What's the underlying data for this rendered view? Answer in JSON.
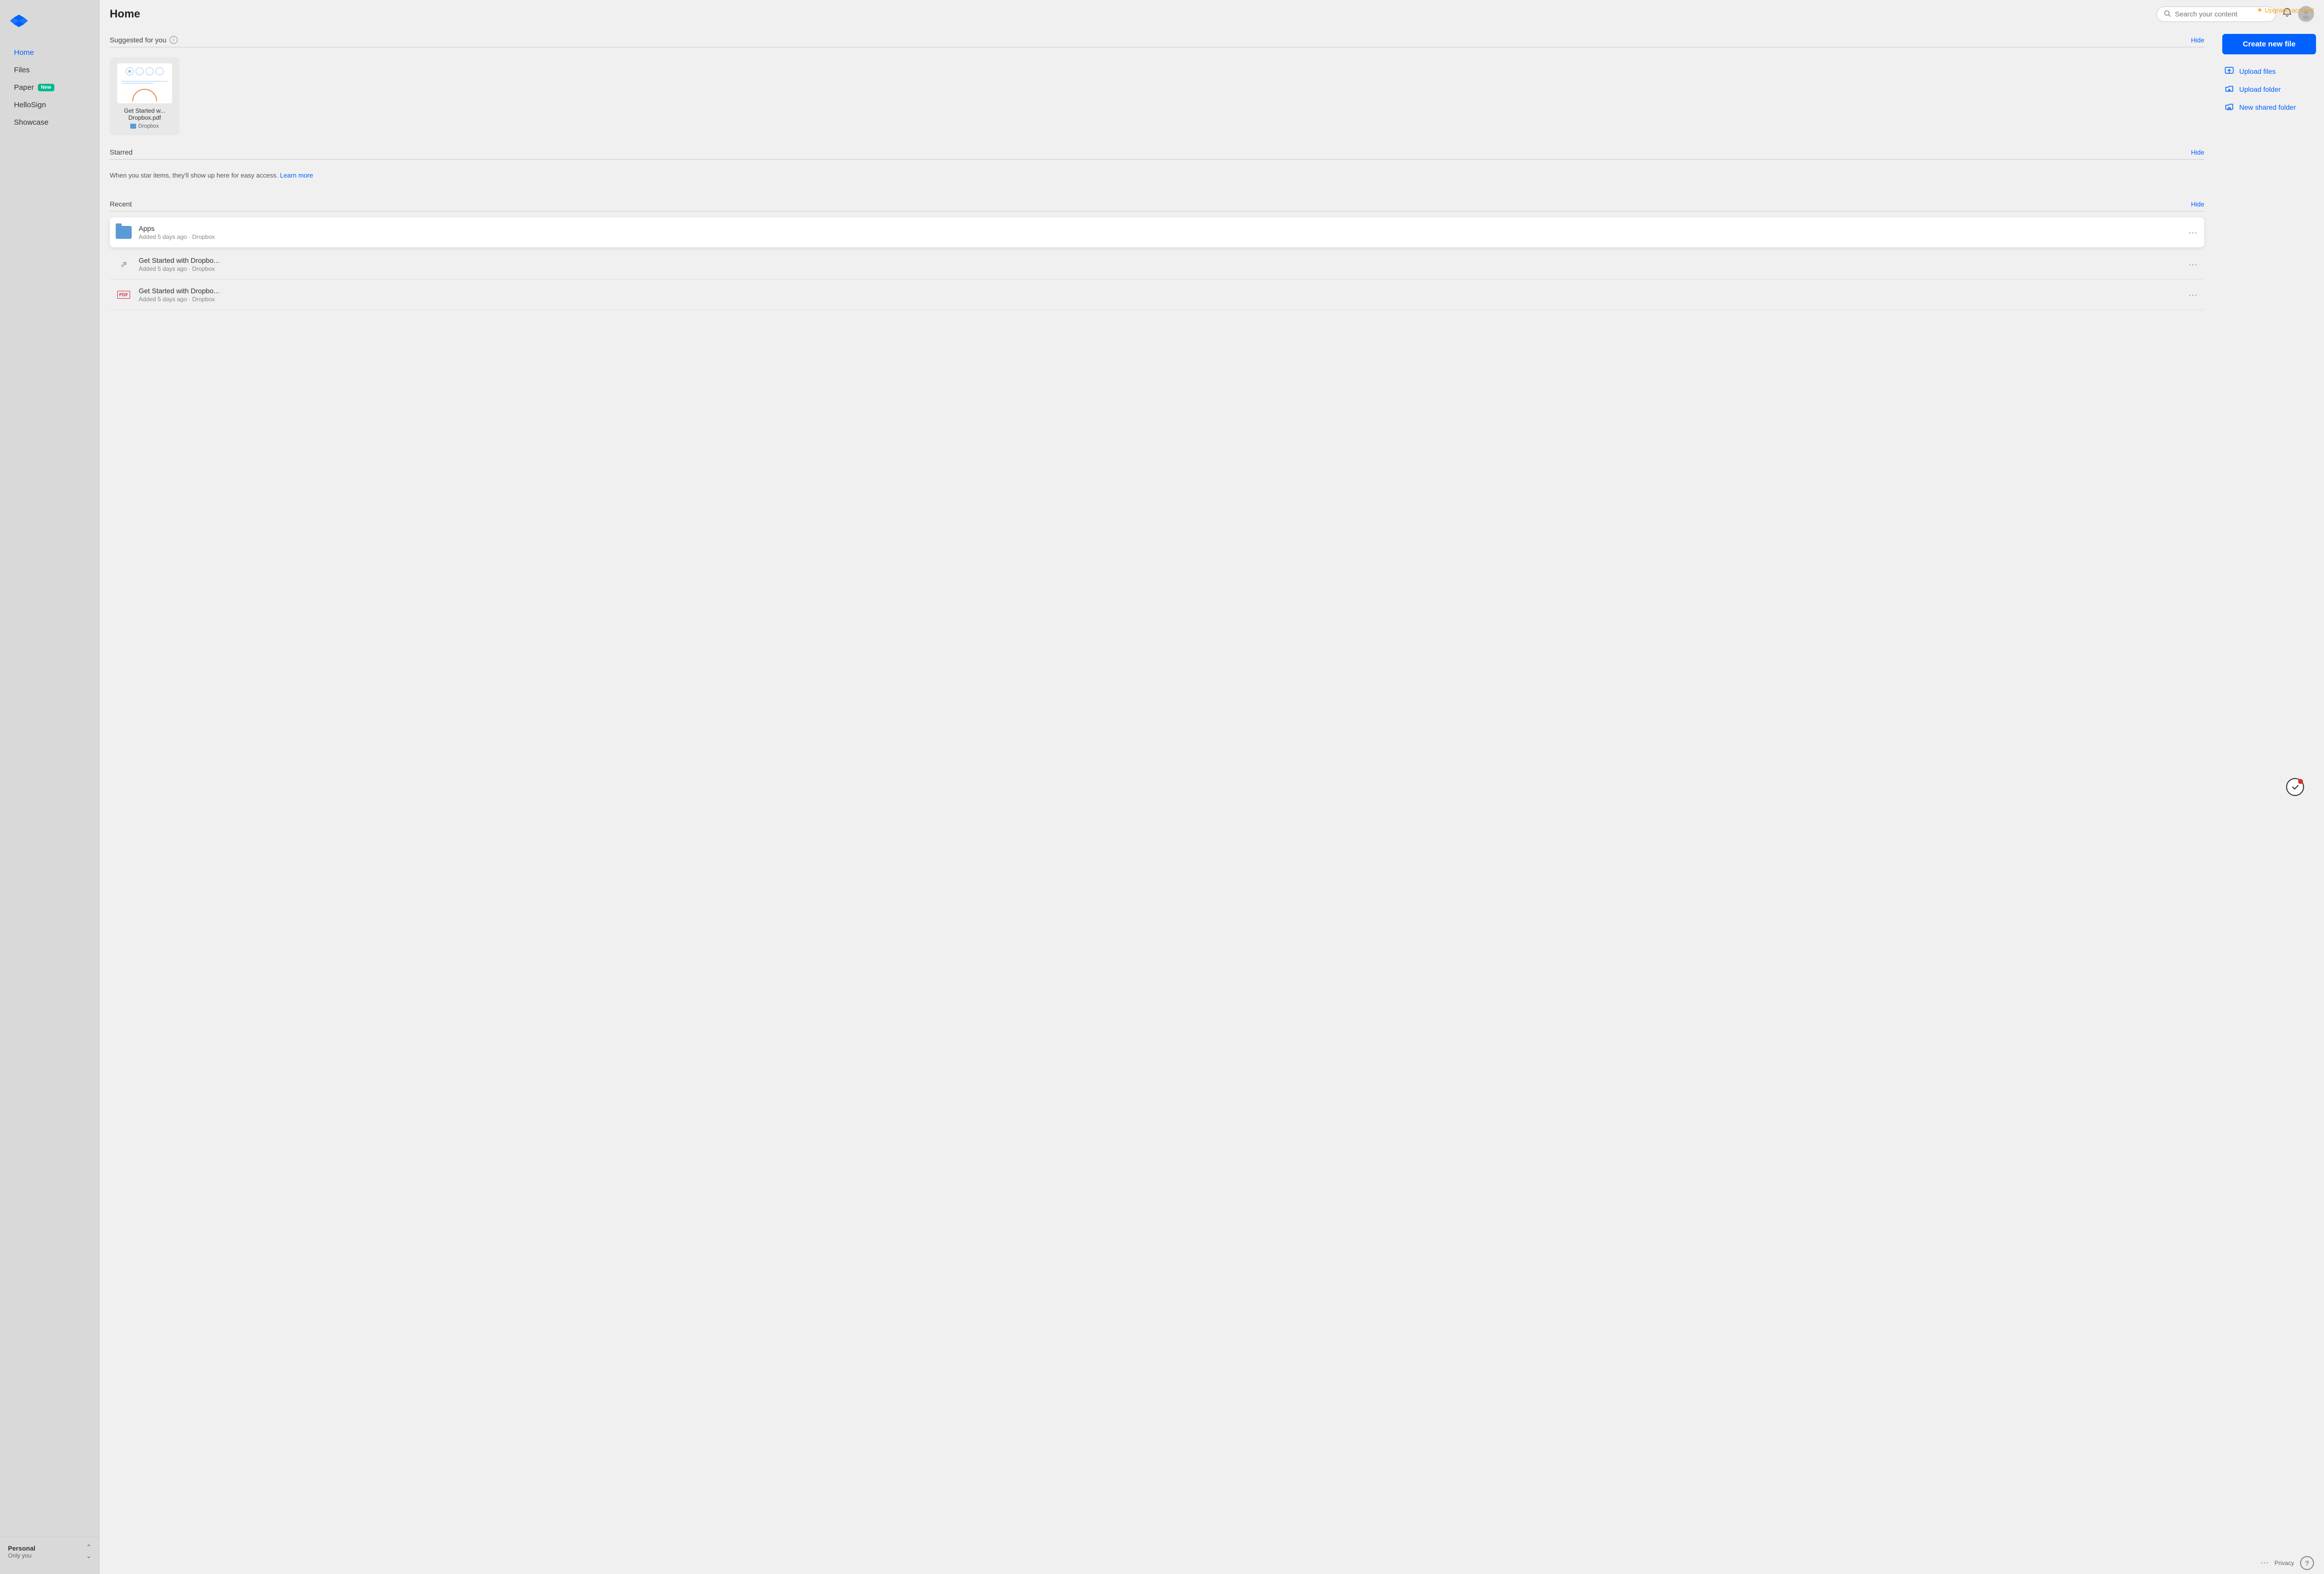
{
  "meta": {
    "upgrade_label": "Upgrade account"
  },
  "sidebar": {
    "items": [
      {
        "id": "home",
        "label": "Home",
        "active": true,
        "badge": null
      },
      {
        "id": "files",
        "label": "Files",
        "active": false,
        "badge": null
      },
      {
        "id": "paper",
        "label": "Paper",
        "active": false,
        "badge": "New"
      },
      {
        "id": "hellosign",
        "label": "HelloSign",
        "active": false,
        "badge": null
      },
      {
        "id": "showcase",
        "label": "Showcase",
        "active": false,
        "badge": null
      }
    ],
    "footer": {
      "title": "Personal",
      "subtitle": "Only you"
    }
  },
  "header": {
    "title": "Home",
    "search_placeholder": "Search your content"
  },
  "suggested": {
    "section_title": "Suggested for you",
    "hide_label": "Hide",
    "file": {
      "name": "Get Started w... Dropbox.pdf",
      "folder": "Dropbox"
    }
  },
  "starred": {
    "section_title": "Starred",
    "hide_label": "Hide",
    "empty_text": "When you star items, they'll show up here for easy access.",
    "learn_more": "Learn more"
  },
  "recent": {
    "section_title": "Recent",
    "hide_label": "Hide",
    "items": [
      {
        "id": "apps",
        "name": "Apps",
        "meta": "Added 5 days ago · Dropbox",
        "type": "folder"
      },
      {
        "id": "shortcut",
        "name": "Get Started with Dropbo...",
        "meta": "Added 5 days ago · Dropbox",
        "type": "link"
      },
      {
        "id": "pdf",
        "name": "Get Started with Dropbo...",
        "meta": "Added 5 days ago · Dropbox",
        "type": "pdf"
      }
    ]
  },
  "actions": {
    "create_label": "Create new file",
    "upload_files_label": "Upload files",
    "upload_folder_label": "Upload folder",
    "new_shared_folder_label": "New shared folder"
  },
  "bottom": {
    "privacy_label": "Privacy",
    "help_label": "?"
  }
}
